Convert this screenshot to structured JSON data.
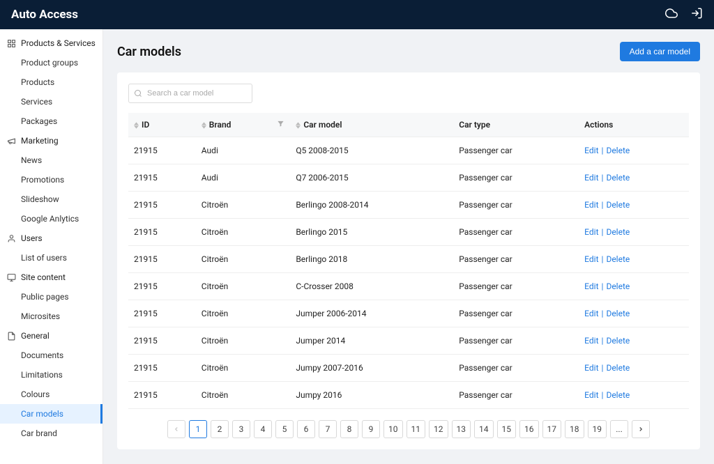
{
  "app_title": "Auto Access",
  "sidebar": [
    {
      "head": "Products & Services",
      "icon": "box",
      "items": [
        "Product groups",
        "Products",
        "Services",
        "Packages"
      ]
    },
    {
      "head": "Marketing",
      "icon": "mega",
      "items": [
        "News",
        "Promotions",
        "Slideshow",
        "Google Anlytics"
      ]
    },
    {
      "head": "Users",
      "icon": "user",
      "items": [
        "List of users"
      ]
    },
    {
      "head": "Site content",
      "icon": "screen",
      "items": [
        "Public pages",
        "Microsites"
      ]
    },
    {
      "head": "General",
      "icon": "doc",
      "items": [
        "Documents",
        "Limitations",
        "Colours",
        "Car models",
        "Car brand"
      ]
    }
  ],
  "active_item": "Car models",
  "page": {
    "title": "Car models",
    "add_button": "Add a car model",
    "search_placeholder": "Search a car model"
  },
  "columns": [
    "ID",
    "Brand",
    "Car model",
    "Car type",
    "Actions"
  ],
  "action_labels": {
    "edit": "Edit",
    "delete": "Delete"
  },
  "rows": [
    {
      "id": "21915",
      "brand": "Audi",
      "model": "Q5 2008-2015",
      "type": "Passenger car"
    },
    {
      "id": "21915",
      "brand": "Audi",
      "model": "Q7 2006-2015",
      "type": "Passenger car"
    },
    {
      "id": "21915",
      "brand": "Citroën",
      "model": "Berlingo 2008-2014",
      "type": "Passenger car"
    },
    {
      "id": "21915",
      "brand": "Citroën",
      "model": "Berlingo 2015",
      "type": "Passenger car"
    },
    {
      "id": "21915",
      "brand": "Citroën",
      "model": "Berlingo 2018",
      "type": "Passenger car"
    },
    {
      "id": "21915",
      "brand": "Citroën",
      "model": "C-Crosser 2008",
      "type": "Passenger car"
    },
    {
      "id": "21915",
      "brand": "Citroën",
      "model": "Jumper 2006-2014",
      "type": "Passenger car"
    },
    {
      "id": "21915",
      "brand": "Citroën",
      "model": "Jumper 2014",
      "type": "Passenger car"
    },
    {
      "id": "21915",
      "brand": "Citroën",
      "model": "Jumpy 2007-2016",
      "type": "Passenger car"
    },
    {
      "id": "21915",
      "brand": "Citroën",
      "model": "Jumpy 2016",
      "type": "Passenger car"
    }
  ],
  "pagination": {
    "current": "1",
    "pages": [
      "1",
      "2",
      "3",
      "4",
      "5",
      "6",
      "7",
      "8",
      "9",
      "10",
      "11",
      "12",
      "13",
      "14",
      "15",
      "16",
      "17",
      "18",
      "19",
      "..."
    ]
  }
}
